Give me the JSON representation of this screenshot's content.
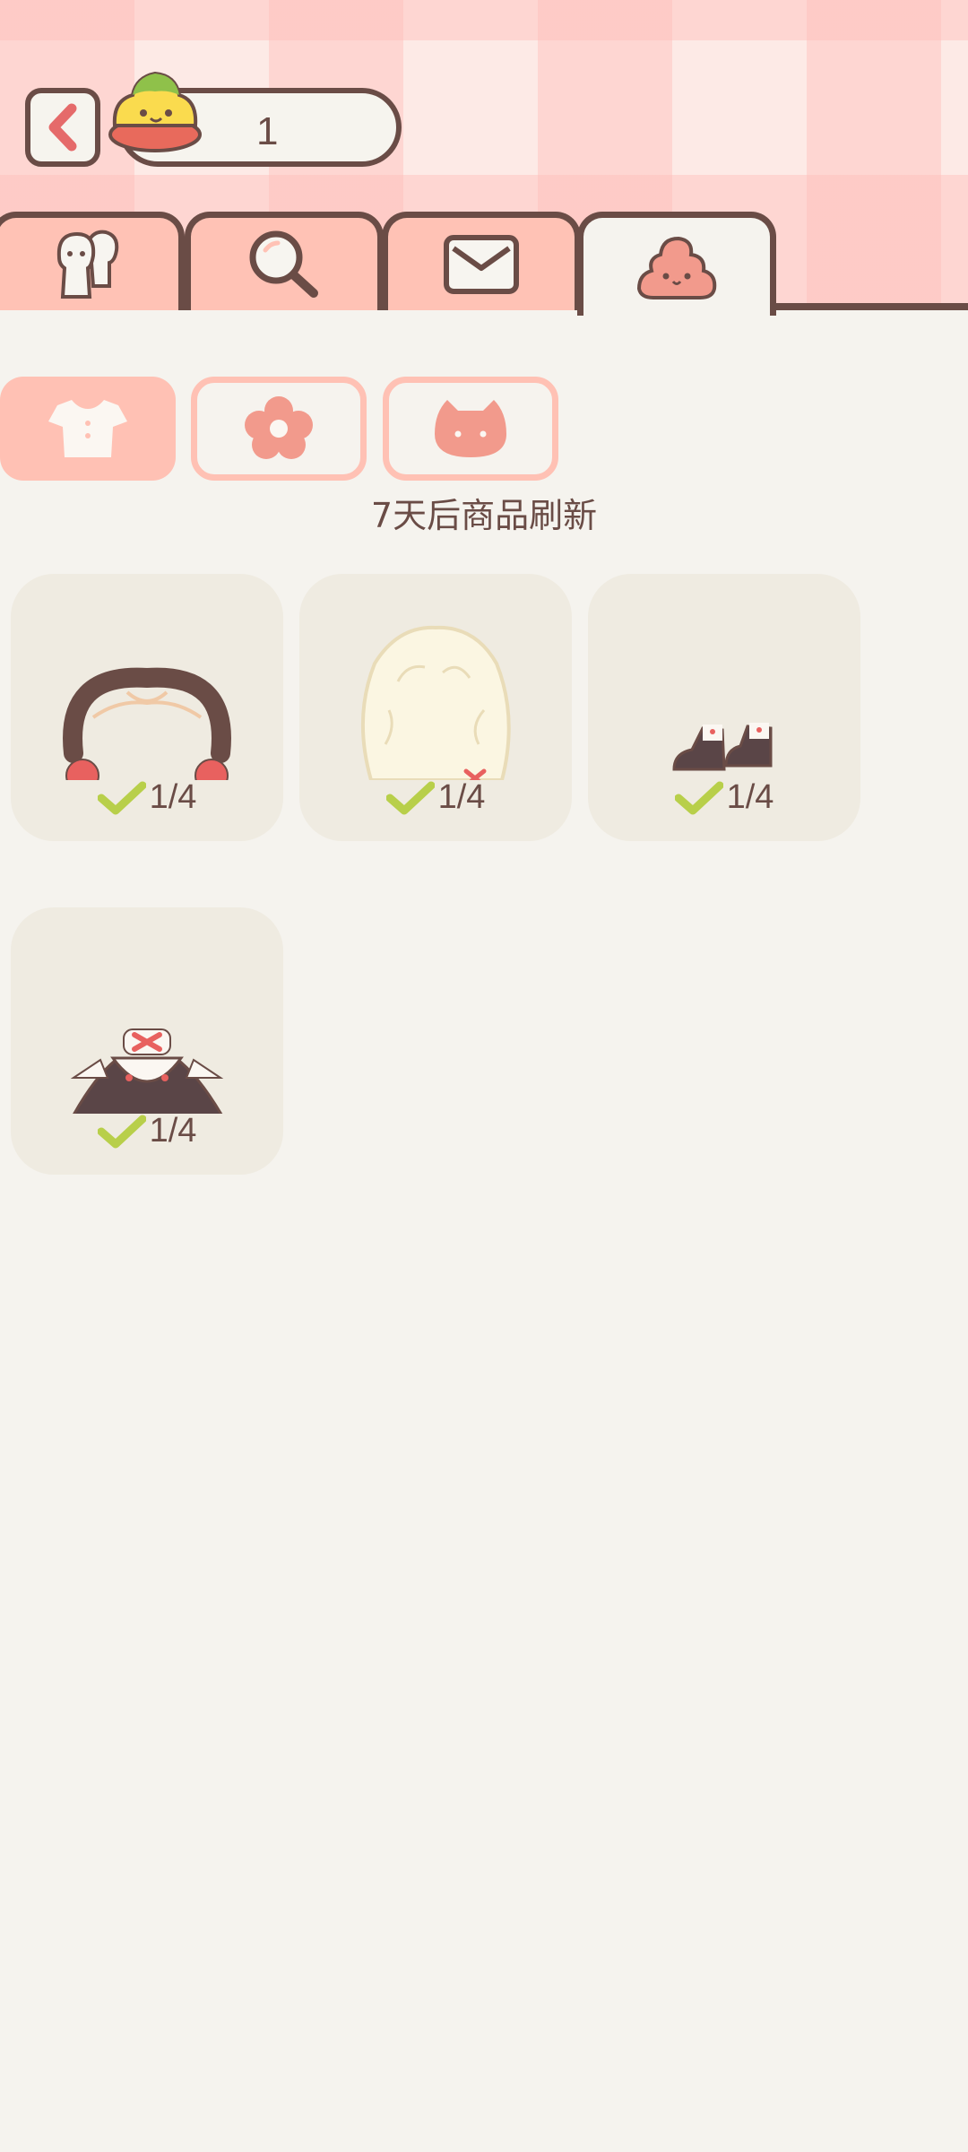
{
  "header": {
    "currency_count": "1"
  },
  "tabs": [
    {
      "name": "friends",
      "icon": "friends-icon",
      "active": false
    },
    {
      "name": "search",
      "icon": "magnifier-icon",
      "active": false
    },
    {
      "name": "mail",
      "icon": "envelope-icon",
      "active": false
    },
    {
      "name": "shop",
      "icon": "blob-icon",
      "active": true
    }
  ],
  "categories": [
    {
      "icon": "shirt-icon",
      "active": true
    },
    {
      "icon": "flower-icon",
      "active": false
    },
    {
      "icon": "cat-icon",
      "active": false
    }
  ],
  "refresh_text": "7天后商品刷新",
  "items": [
    {
      "icon": "headdress-icon",
      "count": "1/4"
    },
    {
      "icon": "wig-icon",
      "count": "1/4"
    },
    {
      "icon": "shoes-icon",
      "count": "1/4"
    },
    {
      "icon": "dress-icon",
      "count": "1/4"
    }
  ],
  "colors": {
    "accent": "#ffc1b4",
    "outline": "#6a4c46",
    "check": "#b8cf4a",
    "background": "#f5f3ee"
  }
}
